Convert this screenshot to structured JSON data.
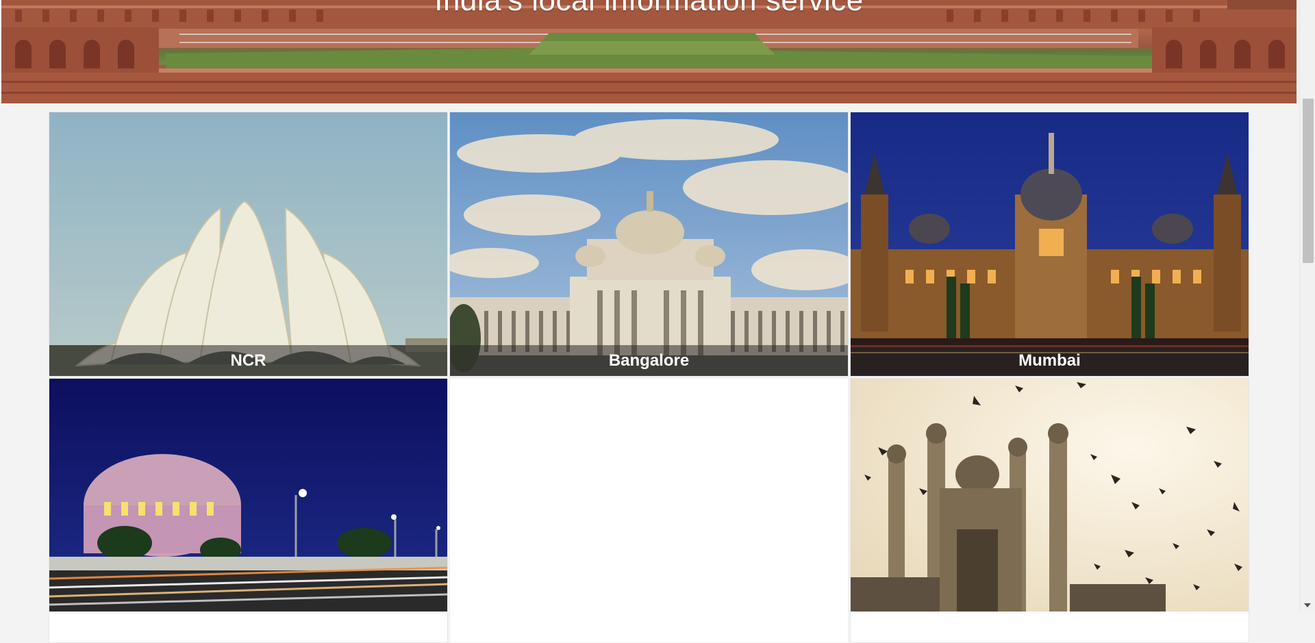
{
  "hero": {
    "title": "India's local information service",
    "image": "red-fort-image"
  },
  "cities": [
    {
      "name": "NCR",
      "image": "lotus-temple-image"
    },
    {
      "name": "Bangalore",
      "image": "vidhana-soudha-image"
    },
    {
      "name": "Mumbai",
      "image": "cst-station-image"
    },
    {
      "name": "",
      "image": "valluvar-kottam-image"
    },
    {
      "name": "",
      "image": "blank-tile"
    },
    {
      "name": "",
      "image": "charminar-image"
    }
  ],
  "colors": {
    "page_background": "#f3f3f3",
    "caption_background": "rgba(40,40,40,0.55)",
    "caption_text": "#ffffff"
  }
}
